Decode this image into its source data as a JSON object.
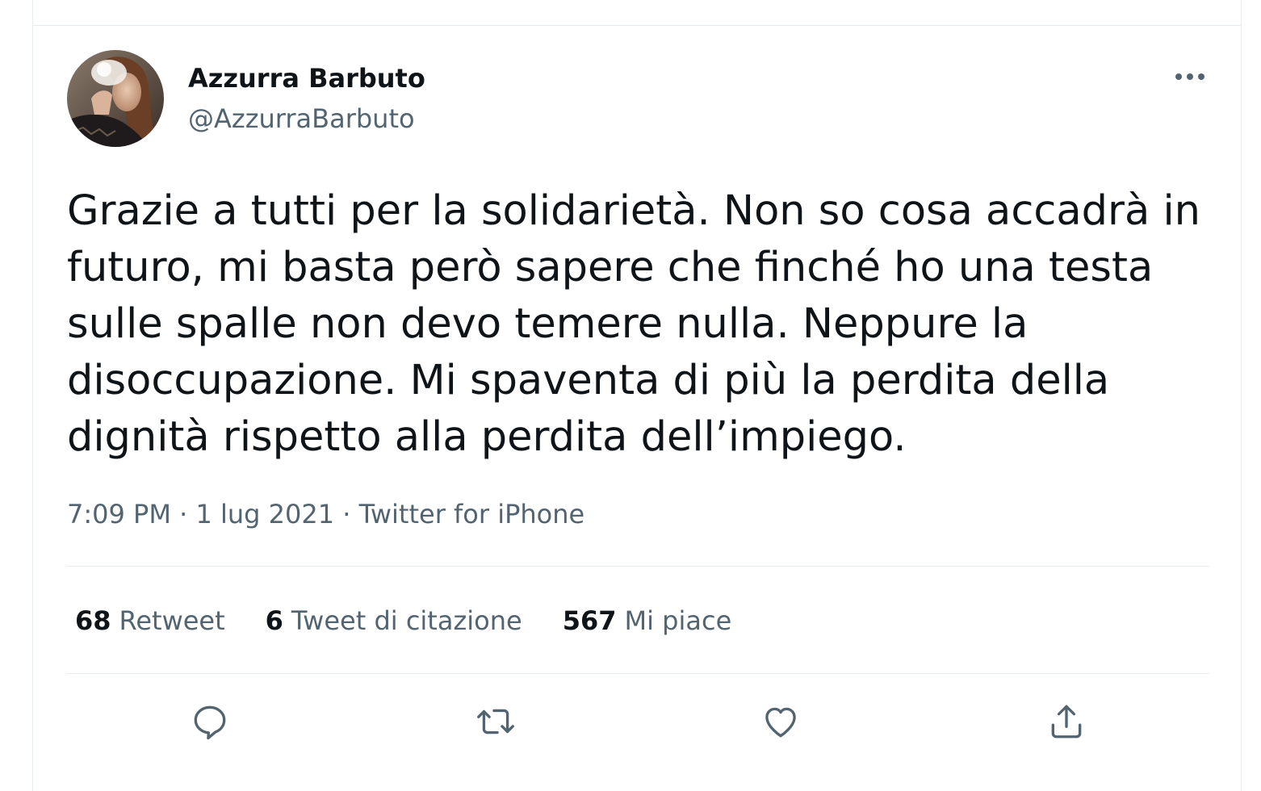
{
  "author": {
    "name": "Azzurra Barbuto",
    "handle": "@AzzurraBarbuto",
    "avatar_icon": "profile-photo"
  },
  "tweet": {
    "lines": [
      "Grazie a tutti per la solidarietà. Non so cosa accadrà in",
      "futuro, mi basta però sapere che finché ho una testa",
      "sulle spalle non devo temere nulla. Neppure la",
      "disoccupazione. Mi spaventa di più la perdita della",
      "dignità rispetto alla perdita dell’impiego."
    ],
    "time": "7:09 PM",
    "separator": "·",
    "date": "1 lug 2021",
    "source": "Twitter for iPhone"
  },
  "stats": {
    "retweets": {
      "count": "68",
      "label": "Retweet"
    },
    "quotes": {
      "count": "6",
      "label": "Tweet di citazione"
    },
    "likes": {
      "count": "567",
      "label": "Mi piace"
    }
  },
  "actions": [
    "reply-icon",
    "retweet-icon",
    "like-icon",
    "share-icon"
  ],
  "colors": {
    "text": "#0f1419",
    "secondary": "#536471",
    "divider": "#e6ecf0"
  }
}
